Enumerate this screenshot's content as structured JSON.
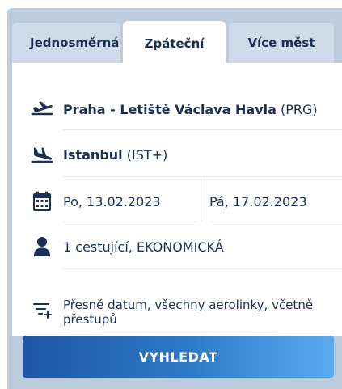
{
  "tabs": [
    {
      "label": "Jednosměrná"
    },
    {
      "label": "Zpáteční"
    },
    {
      "label": "Více měst"
    }
  ],
  "departure": {
    "name": "Praha - Letiště Václava Havla",
    "code": "(PRG)",
    "icon": "airplane-takeoff-icon"
  },
  "arrival": {
    "name": "Istanbul",
    "code": "(IST+)",
    "icon": "airplane-landing-icon"
  },
  "dates": {
    "outbound": "Po, 13.02.2023",
    "return": "Pá, 17.02.2023",
    "icon": "calendar-icon"
  },
  "passengers": {
    "label": "1 cestující, EKONOMICKÁ",
    "icon": "person-icon"
  },
  "filters": {
    "label": "Přesné datum, všechny aerolinky, včetně přestupů",
    "icon": "filter-add-icon"
  },
  "search_button": {
    "label": "VYHLEDAT"
  },
  "colors": {
    "accent": "#1b2f55",
    "panel": "#bccbdd",
    "tab_inactive": "#cfdbea",
    "button_start": "#1f56a3",
    "button_end": "#5aaaf0"
  }
}
